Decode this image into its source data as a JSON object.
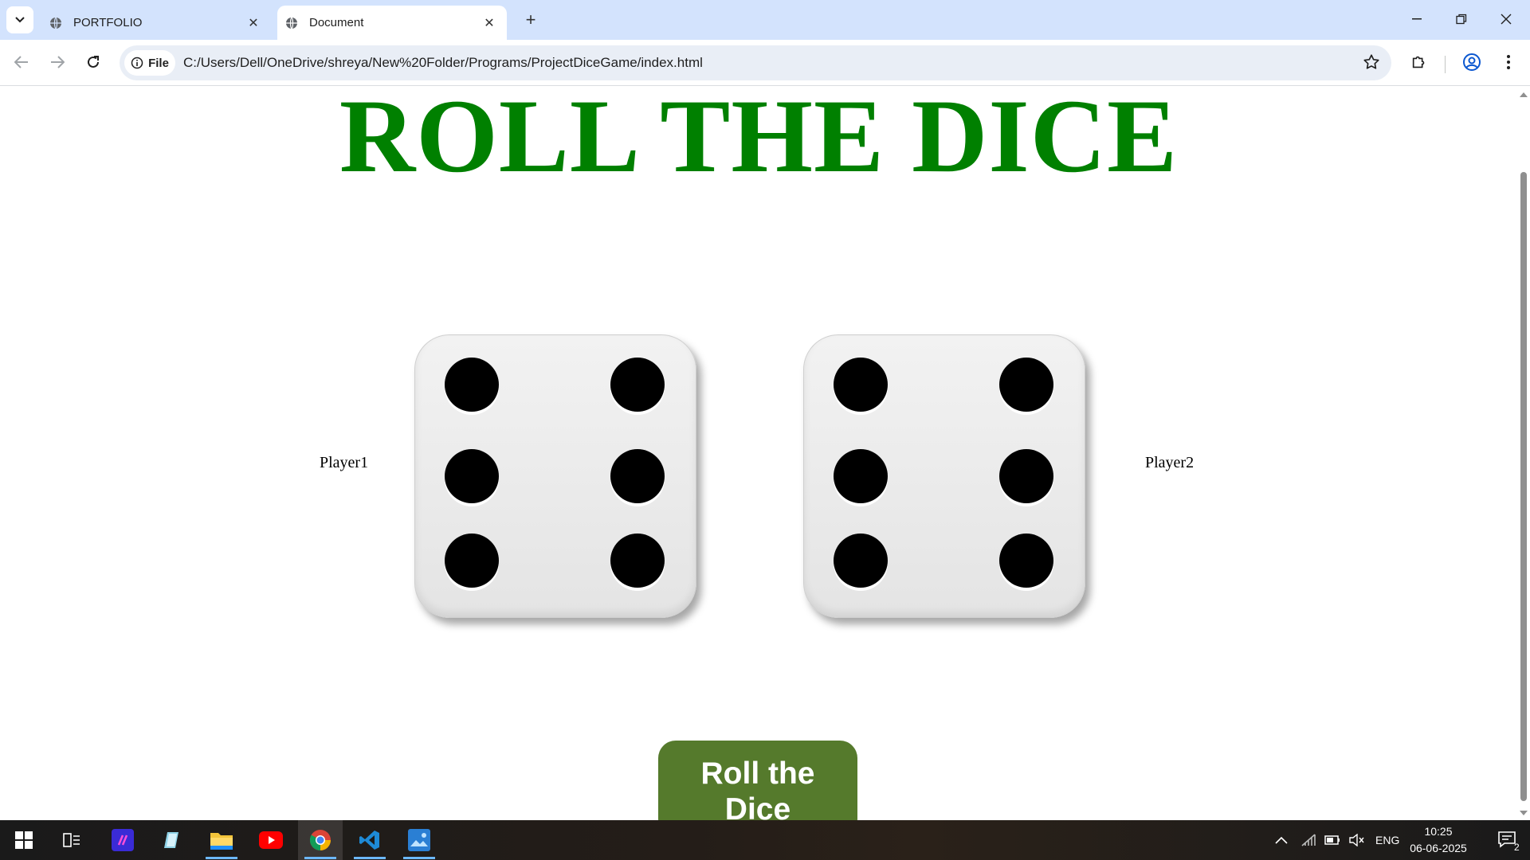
{
  "browser": {
    "tabs": [
      {
        "title": "PORTFOLIO",
        "active": false
      },
      {
        "title": "Document",
        "active": true
      }
    ],
    "site_chip": "File",
    "url": "C:/Users/Dell/OneDrive/shreya/New%20Folder/Programs/ProjectDiceGame/index.html"
  },
  "page": {
    "title": "ROLL THE DICE",
    "player1_label": "Player1",
    "player2_label": "Player2",
    "player1_die_value": 6,
    "player2_die_value": 6,
    "roll_button": {
      "line1": "Roll the",
      "line2": "Dice"
    },
    "colors": {
      "title": "#008000",
      "button": "#557a2c"
    }
  },
  "taskbar": {
    "apps": [
      "start-icon",
      "task-view-icon",
      "app-icon",
      "notes-icon",
      "file-explorer-icon",
      "youtube-icon",
      "chrome-icon",
      "vscode-icon",
      "photos-icon"
    ],
    "language": "ENG",
    "time": "10:25",
    "date": "06-06-2025",
    "notification_count": "2"
  }
}
